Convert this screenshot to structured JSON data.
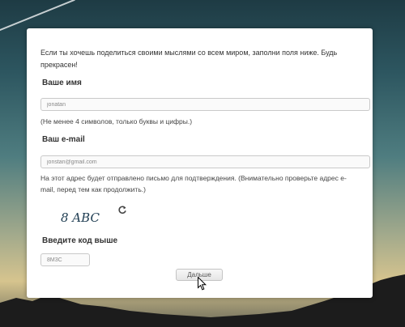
{
  "form": {
    "intro": "Если ты хочешь поделиться своими мыслями со всем миром, заполни поля ниже. Будь прекрасен!",
    "name_label": "Ваше имя",
    "name_value": "jonatan",
    "name_hint": "(Не менее 4 символов, только буквы и цифры.)",
    "email_label": "Ваш e-mail",
    "email_value": "jonstan@gmail.com",
    "email_hint": "На этот адрес будет отправлено письмо для подтверждения. (Внимательно проверьте адрес e-mail, перед тем как продолжить.)",
    "captcha_text": "8 ABC",
    "captcha_refresh_icon": "refresh-icon",
    "code_label": "Введите код выше",
    "code_value": "8M3C",
    "submit_label": "Дальше"
  }
}
